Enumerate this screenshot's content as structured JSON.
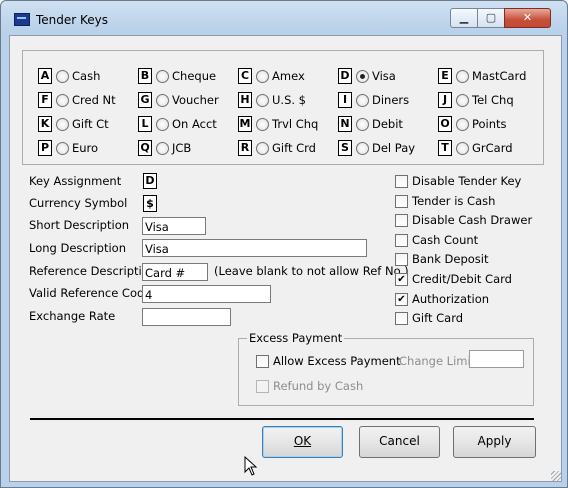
{
  "window": {
    "title": "Tender Keys",
    "caption_buttons": {
      "minimize": "▁",
      "maximize": "▢",
      "close": "✕"
    }
  },
  "tender_keys": [
    {
      "key": "A",
      "label": "Cash",
      "selected": false
    },
    {
      "key": "B",
      "label": "Cheque",
      "selected": false
    },
    {
      "key": "C",
      "label": "Amex",
      "selected": false
    },
    {
      "key": "D",
      "label": "Visa",
      "selected": true
    },
    {
      "key": "E",
      "label": "MastCard",
      "selected": false
    },
    {
      "key": "F",
      "label": "Cred Nt",
      "selected": false
    },
    {
      "key": "G",
      "label": "Voucher",
      "selected": false
    },
    {
      "key": "H",
      "label": "U.S. $",
      "selected": false
    },
    {
      "key": "I",
      "label": "Diners",
      "selected": false
    },
    {
      "key": "J",
      "label": "Tel Chq",
      "selected": false
    },
    {
      "key": "K",
      "label": "Gift Ct",
      "selected": false
    },
    {
      "key": "L",
      "label": "On Acct",
      "selected": false
    },
    {
      "key": "M",
      "label": "Trvl Chq",
      "selected": false
    },
    {
      "key": "N",
      "label": "Debit",
      "selected": false
    },
    {
      "key": "O",
      "label": "Points",
      "selected": false
    },
    {
      "key": "P",
      "label": "Euro",
      "selected": false
    },
    {
      "key": "Q",
      "label": "JCB",
      "selected": false
    },
    {
      "key": "R",
      "label": "Gift Crd",
      "selected": false
    },
    {
      "key": "S",
      "label": "Del Pay",
      "selected": false
    },
    {
      "key": "T",
      "label": "GrCard",
      "selected": false
    }
  ],
  "fields": {
    "key_assignment": {
      "label": "Key Assignment",
      "value": "D"
    },
    "currency_symbol": {
      "label": "Currency Symbol",
      "value": "$"
    },
    "short_description": {
      "label": "Short Description",
      "value": "Visa"
    },
    "long_description": {
      "label": "Long Description",
      "value": "Visa"
    },
    "reference_description": {
      "label": "Reference Description",
      "value": "Card #",
      "hint": "(Leave blank to not allow Ref No.)"
    },
    "valid_reference_code": {
      "label": "Valid Reference Code",
      "value": "4"
    },
    "exchange_rate": {
      "label": "Exchange Rate",
      "value": ""
    }
  },
  "options": [
    {
      "label": "Disable Tender Key",
      "checked": false
    },
    {
      "label": "Tender is Cash",
      "checked": false
    },
    {
      "label": "Disable Cash Drawer",
      "checked": false
    },
    {
      "label": "Cash Count",
      "checked": false
    },
    {
      "label": "Bank Deposit",
      "checked": false
    },
    {
      "label": "Credit/Debit Card",
      "checked": true
    },
    {
      "label": "Authorization",
      "checked": true
    },
    {
      "label": "Gift Card",
      "checked": false
    }
  ],
  "excess_payment": {
    "title": "Excess Payment",
    "allow_label": "Allow Excess Payment",
    "allow_checked": false,
    "change_limit_label": "Change Limit",
    "change_limit_value": "",
    "refund_label": "Refund by Cash",
    "refund_checked": false
  },
  "buttons": {
    "ok": "OK",
    "cancel": "Cancel",
    "apply": "Apply"
  }
}
